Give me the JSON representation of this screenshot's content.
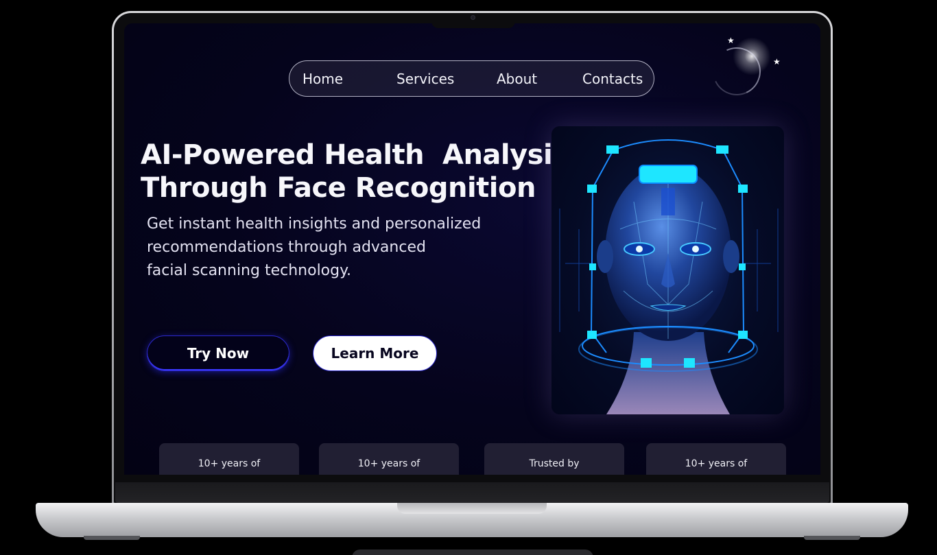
{
  "nav": {
    "items": [
      "Home",
      "Services",
      "About",
      "Contacts"
    ]
  },
  "hero": {
    "title_line1": "AI-Powered Health  Analysis",
    "title_line2": "Through Face Recognition",
    "subtitle_line1": "Get instant health insights and personalized",
    "subtitle_line2": "recommendations through advanced",
    "subtitle_line3": "facial scanning technology.",
    "try_label": "Try Now",
    "learn_label": "Learn More",
    "image_icon": "ai-face-scan-illustration"
  },
  "stats": [
    {
      "label": "10+ years of"
    },
    {
      "label": "10+ years of"
    },
    {
      "label": "Trusted by"
    },
    {
      "label": "10+ years of"
    }
  ],
  "colors": {
    "background": "#05041c",
    "accent": "#2b28c9",
    "scan_cyan": "#1ee6ff",
    "card": "#211f33"
  }
}
